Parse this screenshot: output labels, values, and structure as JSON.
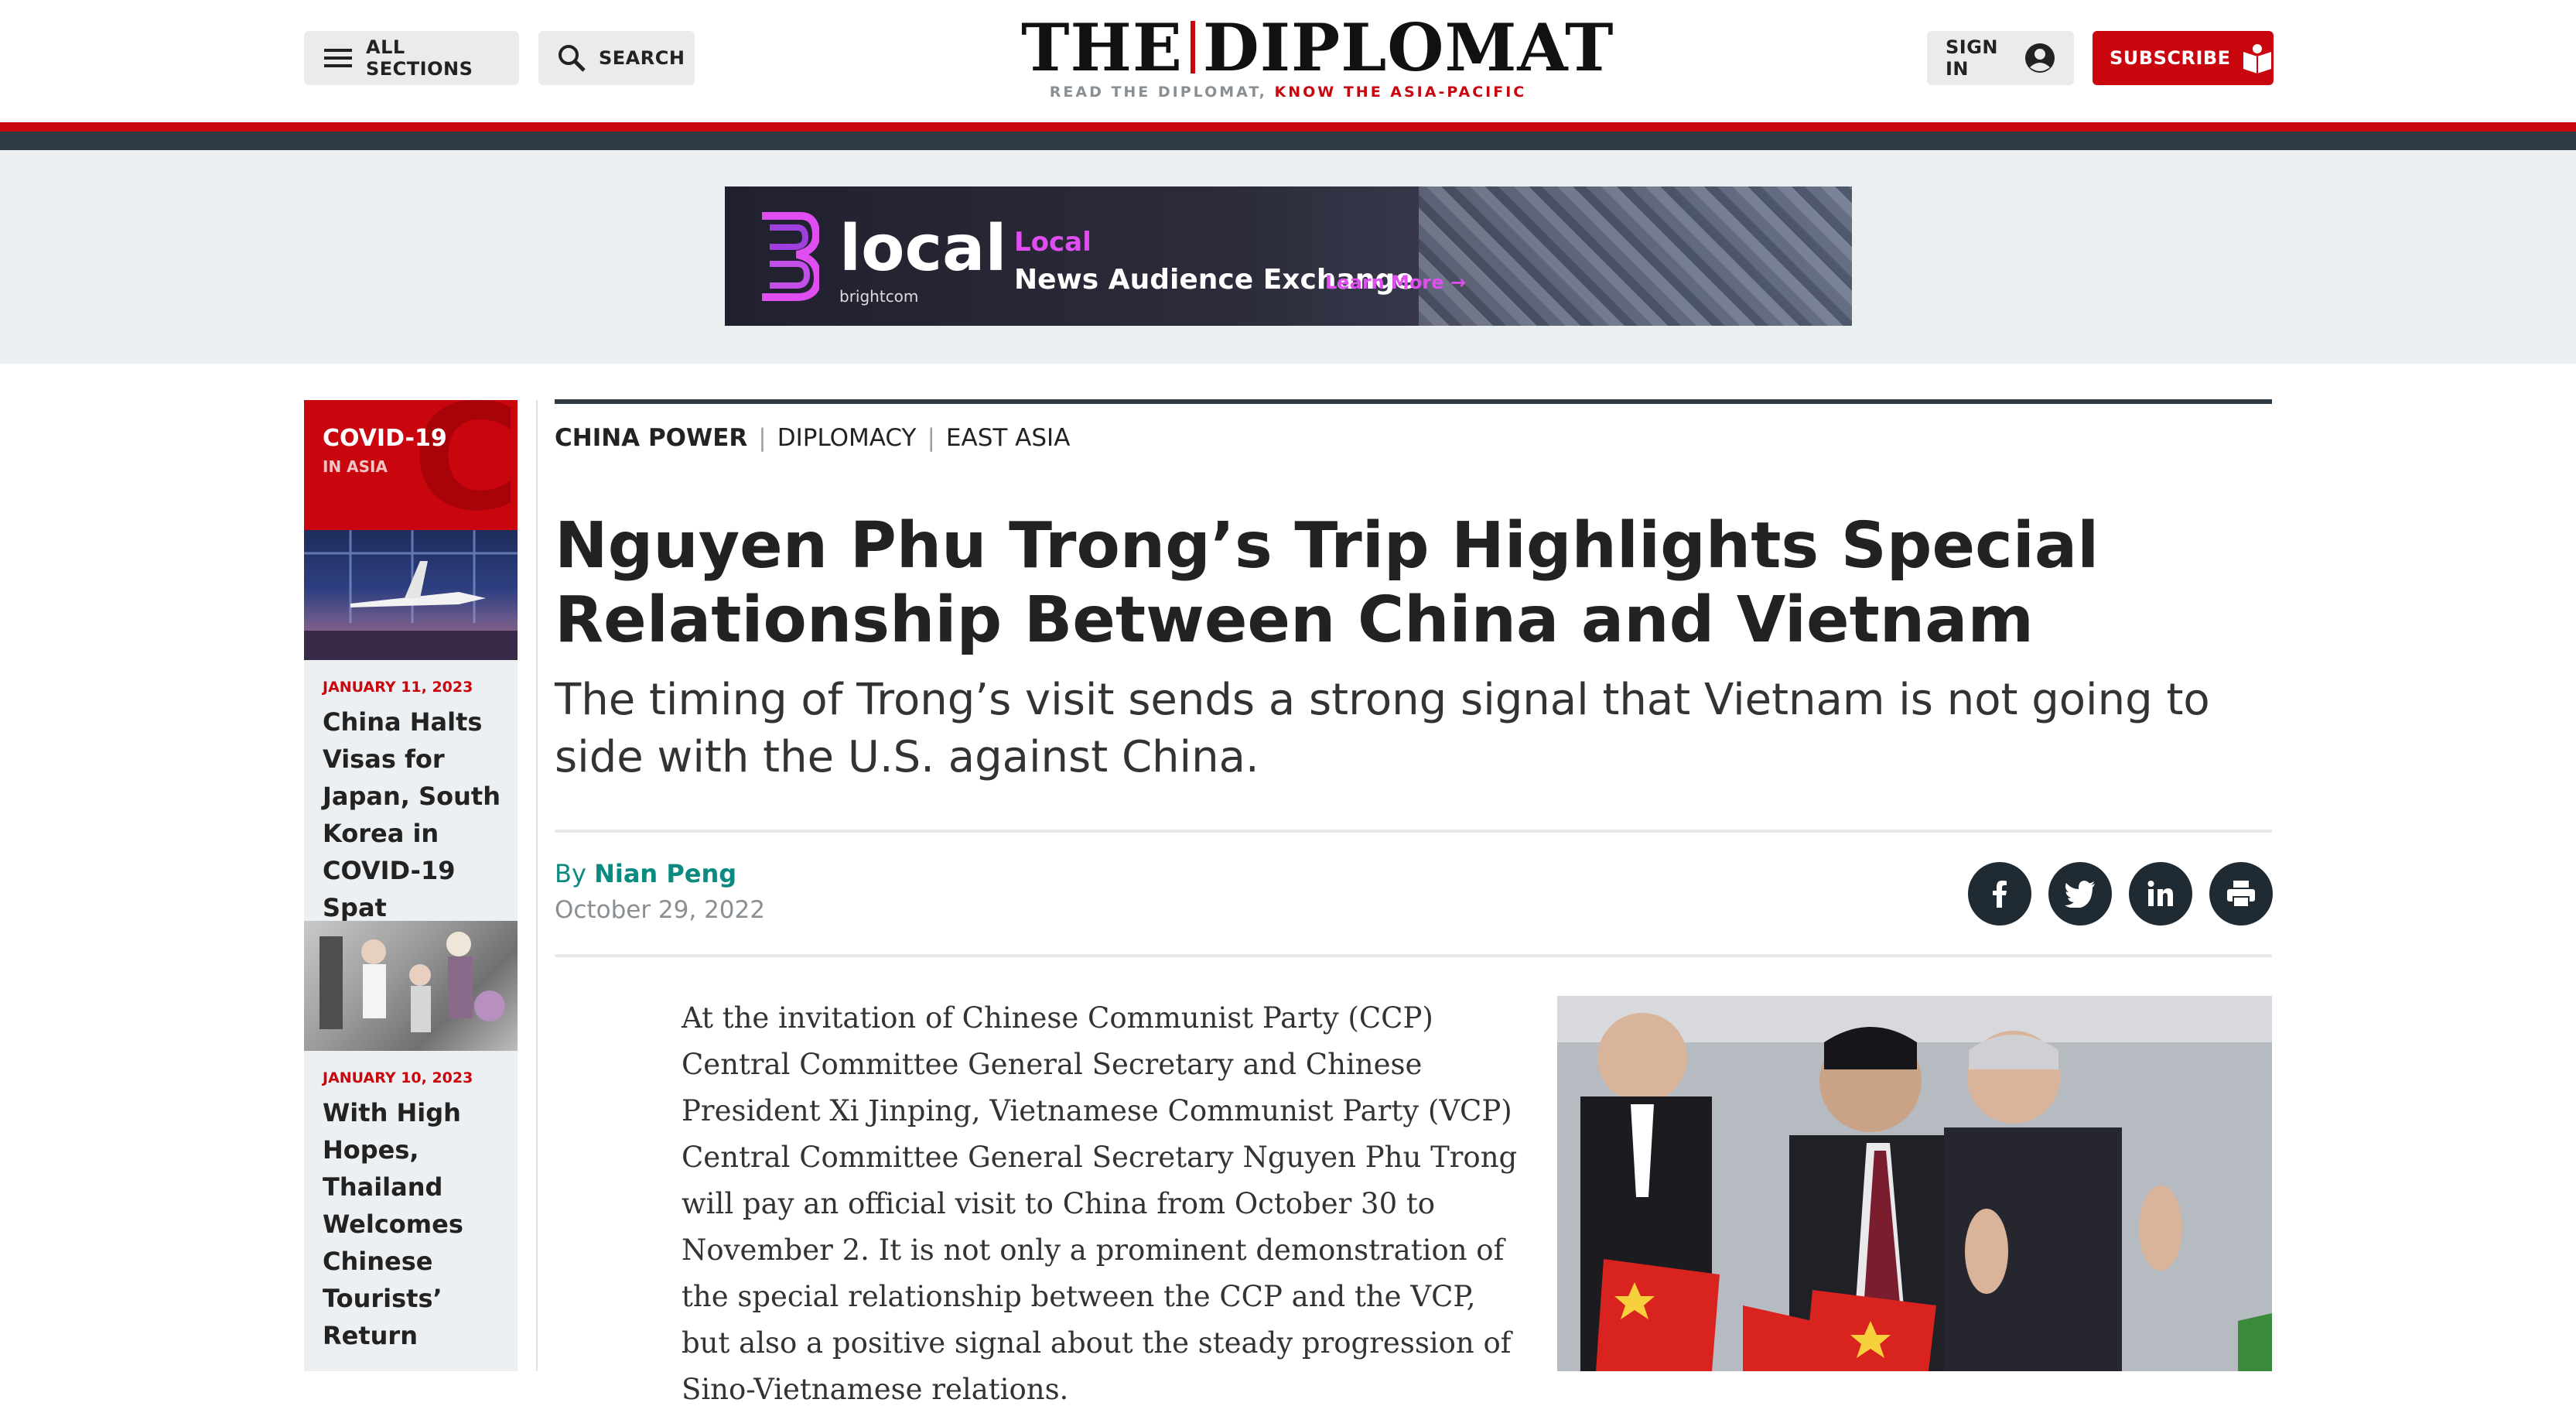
{
  "header": {
    "all_sections": "ALL SECTIONS",
    "search": "SEARCH",
    "logo_left": "THE",
    "logo_right": "DIPLOMAT",
    "tagline_grey": "READ THE DIPLOMAT,",
    "tagline_red": "KNOW THE ASIA-PACIFIC",
    "sign_in": "SIGN IN",
    "subscribe": "SUBSCRIBE"
  },
  "ad": {
    "brand": "local",
    "brand_sub": "brightcom",
    "line1": "Local",
    "line2": "News Audience Exchange",
    "cta": "Learn More"
  },
  "sidebar": {
    "section_title": "COVID-19",
    "section_sub": "IN ASIA",
    "items": [
      {
        "date": "JANUARY 11, 2023",
        "headline": "China Halts Visas for Japan, South Korea in COVID-19 Spat"
      },
      {
        "date": "JANUARY 10, 2023",
        "headline": "With High Hopes, Thailand Welcomes Chinese Tourists’ Return"
      }
    ]
  },
  "article": {
    "categories": [
      "CHINA POWER",
      "DIPLOMACY",
      "EAST ASIA"
    ],
    "title": "Nguyen Phu Trong’s Trip Highlights Special Relationship Between China and Vietnam",
    "subtitle": "The timing of Trong’s visit sends a strong signal that Vietnam is not going to side with the U.S. against China.",
    "by": "By",
    "author": "Nian Peng",
    "date": "October 29, 2022",
    "body": "At the invitation of Chinese Communist Party (CCP) Central Committee General Secretary and Chinese President Xi Jinping, Vietnamese Communist Party (VCP) Central Committee General Secretary Nguyen Phu Trong will pay an official visit to China from October 30 to November 2. It is not only a prominent demonstration of the special relationship between the CCP and the VCP, but also a positive signal about the steady progression of Sino-Vietnamese relations."
  },
  "share_icons": [
    "facebook-icon",
    "twitter-icon",
    "linkedin-icon",
    "print-icon"
  ],
  "colors": {
    "brand_red": "#c9050d",
    "dark_navy": "#2e3a44",
    "author_teal": "#0b8a80",
    "ad_magenta": "#e04df0"
  }
}
